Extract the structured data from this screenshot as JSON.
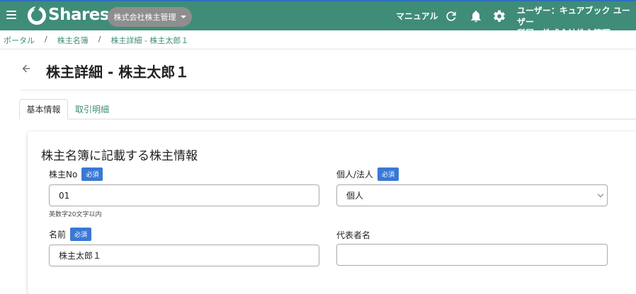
{
  "header": {
    "app_name": "Shares",
    "company_selector": "株式会社株主管理",
    "manual": "マニュアル",
    "user_line": "ユーザー：キュアブック ユーザー",
    "affiliation_line": "所属：株式会社株主管理",
    "colors": {
      "bar": "#3f8c79",
      "top_border": "#2f6ec2",
      "selector_bg": "#8e8e8e"
    },
    "icons": [
      "menu-icon",
      "refresh-icon",
      "bell-icon",
      "gear-icon"
    ]
  },
  "breadcrumb": [
    "ポータル",
    "株主名簿",
    "株主詳細 - 株主太郎１"
  ],
  "breadcrumb_separator": "/",
  "page": {
    "title": "株主詳細 - 株主太郎１"
  },
  "tabs": [
    {
      "label": "基本情報",
      "active": true
    },
    {
      "label": "取引明細",
      "active": false
    }
  ],
  "form": {
    "section_title": "株主名簿に記載する株主情報",
    "required_badge": "必須",
    "required_color": "#3a78d4",
    "fields": {
      "shareholder_no": {
        "label": "株主No",
        "value": "01",
        "hint": "英数字20文字以内",
        "required": true
      },
      "entity_type": {
        "label": "個人/法人",
        "value": "個人",
        "required": true
      },
      "name": {
        "label": "名前",
        "value": "株主太郎１",
        "required": true
      },
      "representative": {
        "label": "代表者名",
        "value": ""
      }
    }
  }
}
